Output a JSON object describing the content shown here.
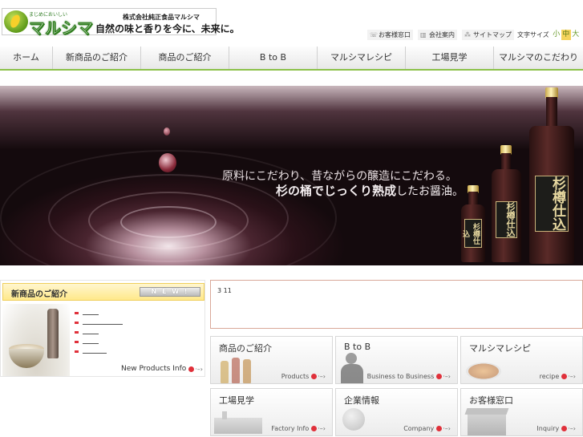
{
  "header": {
    "logo_tagline": "まじめにおいしい",
    "logo_mark": "マルシマ",
    "company": "株式会社純正食品マルシマ",
    "slogan": "自然の味と香りを今に、未来に。",
    "utility": [
      {
        "label": "お客様窓口",
        "icon": "phone-icon"
      },
      {
        "label": "会社案内",
        "icon": "building-icon"
      },
      {
        "label": "サイトマップ",
        "icon": "sitemap-icon"
      }
    ],
    "fontsize": {
      "label": "文字サイズ",
      "small": "小",
      "medium": "中",
      "large": "大",
      "active": "medium"
    }
  },
  "nav": [
    "ホーム",
    "新商品のご紹介",
    "商品のご紹介",
    "B to B",
    "マルシマレシピ",
    "工場見学",
    "マルシマのこだわり"
  ],
  "hero": {
    "line1": "原料にこだわり、昔ながらの醸造にこだわる。",
    "line2_bold": "杉の桶でじっくり熟成",
    "line2_rest": "したお醤油。",
    "bottle_label": "杉樽仕込"
  },
  "new_products": {
    "title": "新商品のご紹介",
    "badge": "N E W !",
    "items": [
      "",
      "",
      "",
      "",
      ""
    ],
    "more_label": "New Products Info"
  },
  "news": {
    "text": "3 11"
  },
  "tiles": [
    {
      "title": "商品のご紹介",
      "en": "Products"
    },
    {
      "title": "B to B",
      "en": "Business to Business"
    },
    {
      "title": "マルシマレシピ",
      "en": "recipe"
    },
    {
      "title": "工場見学",
      "en": "Factory Info"
    },
    {
      "title": "企業情報",
      "en": "Company"
    },
    {
      "title": "お客様窓口",
      "en": "Inquiry"
    }
  ],
  "colors": {
    "accent_green": "#8cc14a",
    "accent_red": "#e0303a",
    "highlight_yellow": "#f5d35c"
  }
}
